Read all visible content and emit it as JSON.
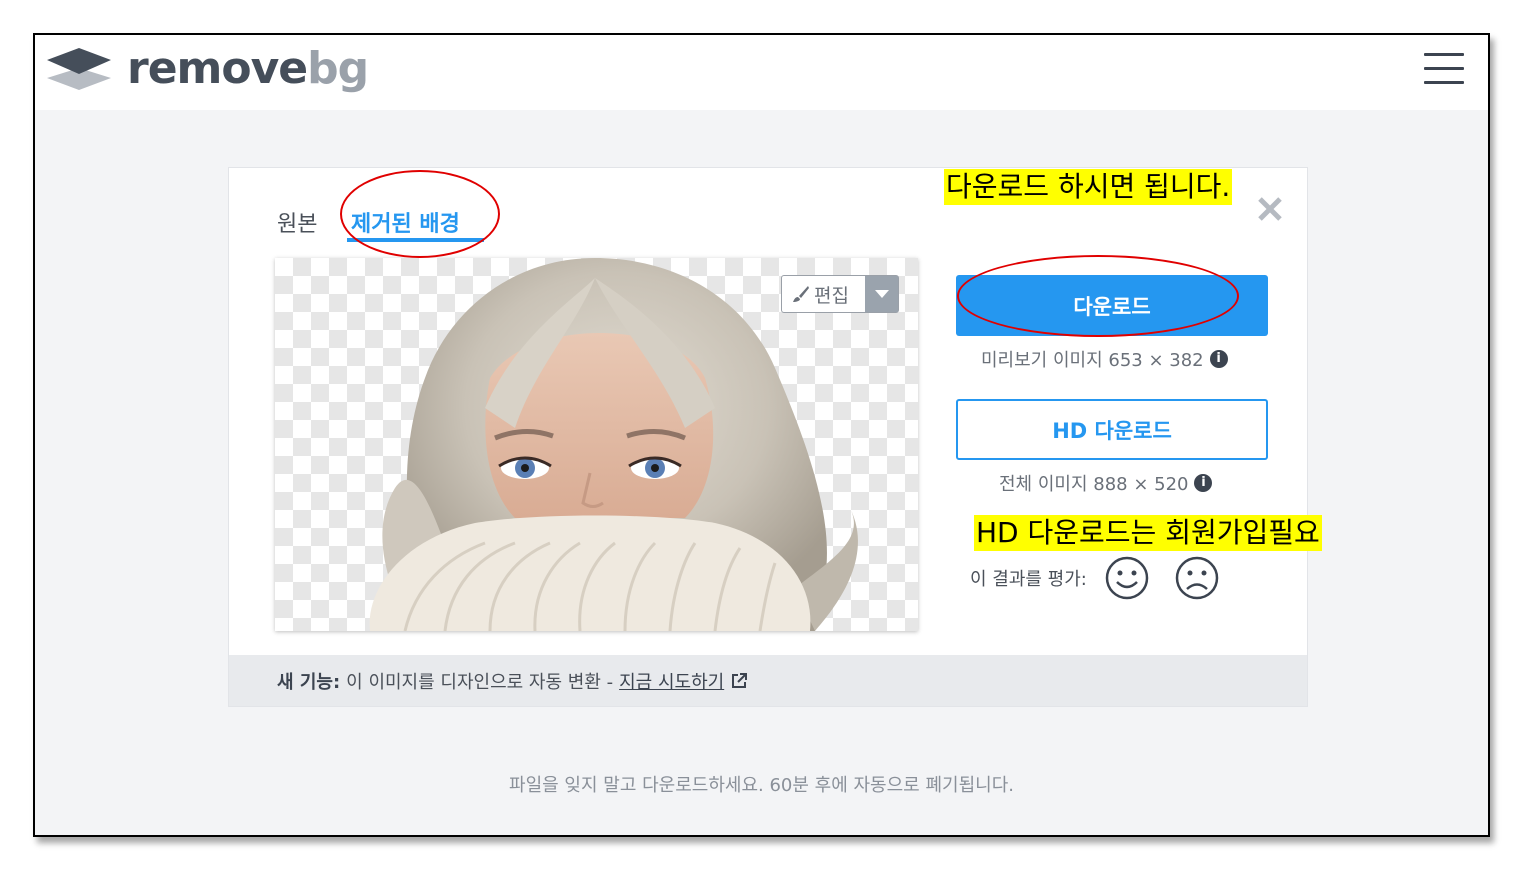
{
  "header": {
    "logo_text_main": "remove",
    "logo_text_accent": "bg",
    "menu_icon": "hamburger-menu-icon"
  },
  "tabs": {
    "original": "원본",
    "removed": "제거된 배경"
  },
  "editor": {
    "edit_label": "편집",
    "brush_icon": "brush-icon",
    "caret_icon": "chevron-down-icon"
  },
  "download": {
    "label": "다운로드",
    "note": "미리보기 이미지 653 × 382"
  },
  "hd_download": {
    "label": "HD 다운로드",
    "note": "전체 이미지 888 × 520"
  },
  "rating": {
    "label": "이 결과를 평가:"
  },
  "card_footer": {
    "feature_label": "새 기능:",
    "text": "이 이미지를 디자인으로 자동 변환 -",
    "link": "지금 시도하기"
  },
  "bottom_note": "파일을 잊지 말고 다운로드하세요. 60분 후에 자동으로 폐기됩니다.",
  "annotations": {
    "top": "다운로드 하시면 됩니다.",
    "hd": "HD 다운로드는 회원가입필요"
  },
  "colors": {
    "accent": "#2597f0",
    "highlight": "#ffff00",
    "circle": "#e00000"
  }
}
